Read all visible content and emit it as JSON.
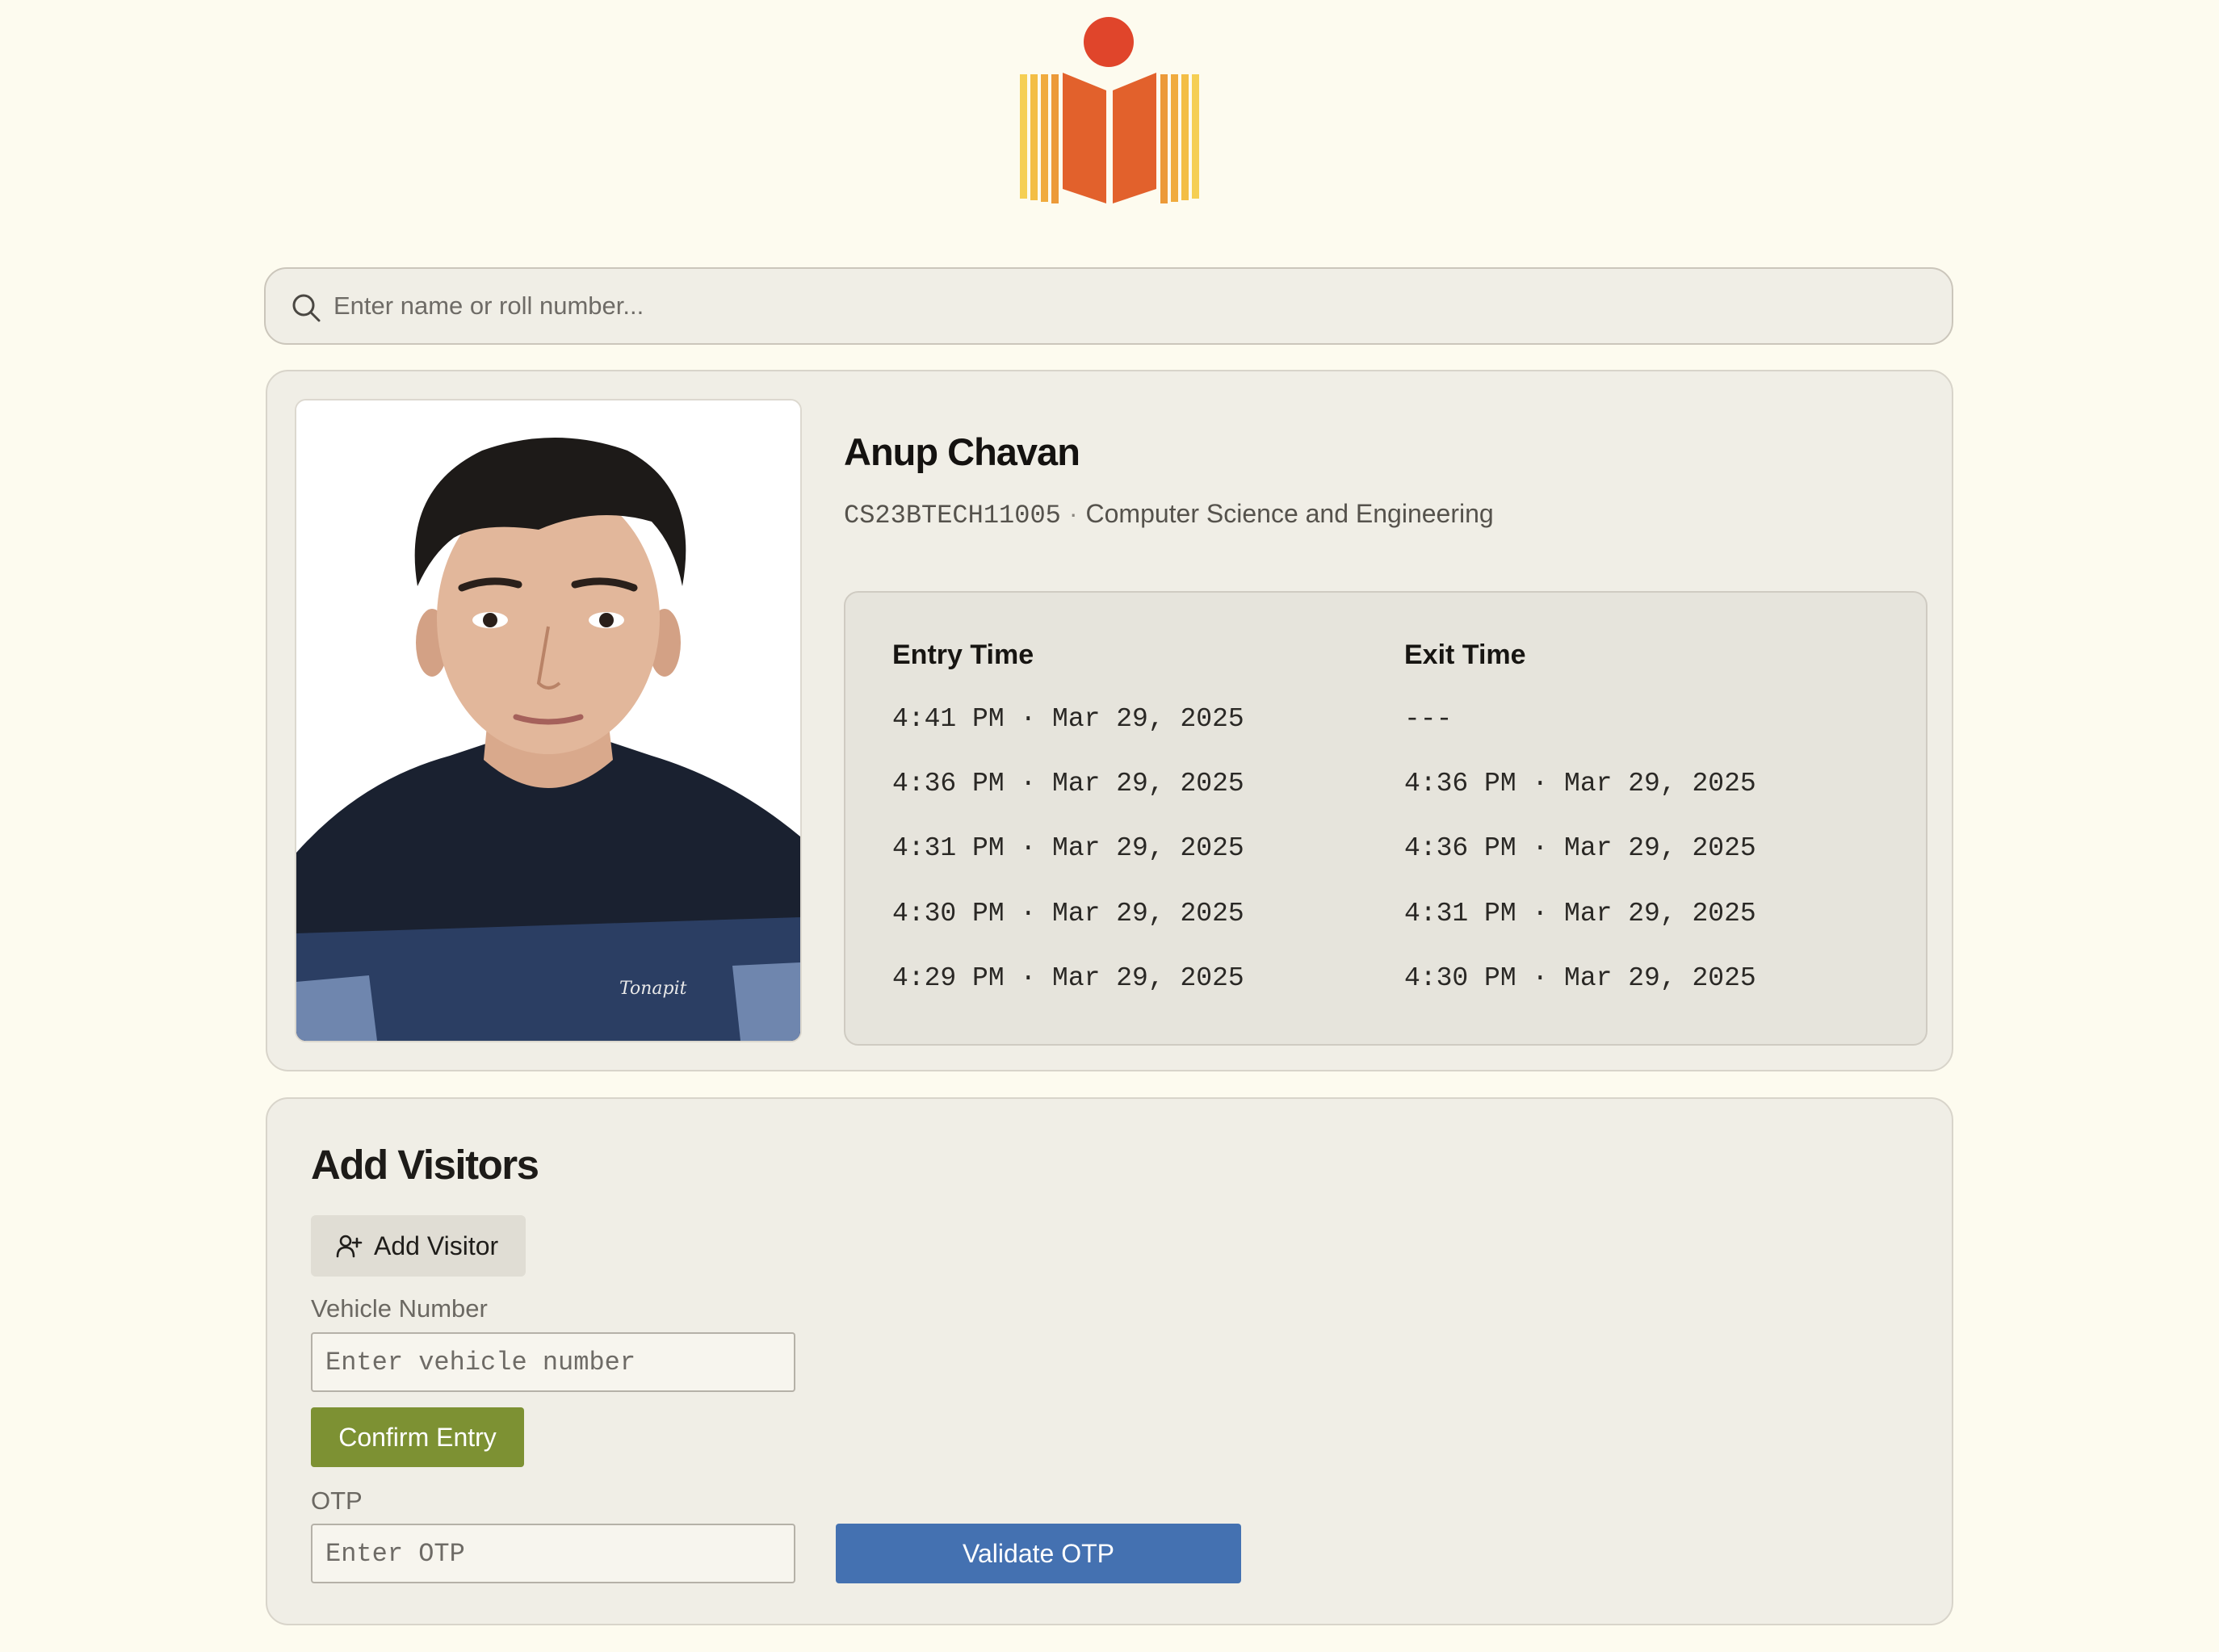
{
  "search": {
    "placeholder": "Enter name or roll number..."
  },
  "student": {
    "name": "Anup Chavan",
    "roll_number": "CS23BTECH11005",
    "separator": "·",
    "department": "Computer Science and Engineering"
  },
  "log": {
    "entry_header": "Entry Time",
    "exit_header": "Exit Time",
    "rows": [
      {
        "entry": "4:41 PM · Mar 29, 2025",
        "exit": "---"
      },
      {
        "entry": "4:36 PM · Mar 29, 2025",
        "exit": "4:36 PM · Mar 29, 2025"
      },
      {
        "entry": "4:31 PM · Mar 29, 2025",
        "exit": "4:36 PM · Mar 29, 2025"
      },
      {
        "entry": "4:30 PM · Mar 29, 2025",
        "exit": "4:31 PM · Mar 29, 2025"
      },
      {
        "entry": "4:29 PM · Mar 29, 2025",
        "exit": "4:30 PM · Mar 29, 2025"
      }
    ]
  },
  "visitors": {
    "title": "Add Visitors",
    "add_visitor_label": "Add Visitor",
    "vehicle_label": "Vehicle Number",
    "vehicle_placeholder": "Enter vehicle number",
    "confirm_label": "Confirm Entry",
    "otp_label": "OTP",
    "otp_placeholder": "Enter OTP",
    "validate_label": "Validate OTP"
  },
  "colors": {
    "page_background": "#fdfbef",
    "card_background": "#f0eee6",
    "confirm_button": "#7d9133",
    "validate_button": "#4471b1",
    "logo_orange": "#e2612c",
    "logo_red": "#e0452b",
    "logo_yellow": "#f2c94c"
  },
  "icons": {
    "logo": "book-with-dot-logo",
    "search": "search-icon",
    "add_visitor": "user-plus-icon"
  }
}
